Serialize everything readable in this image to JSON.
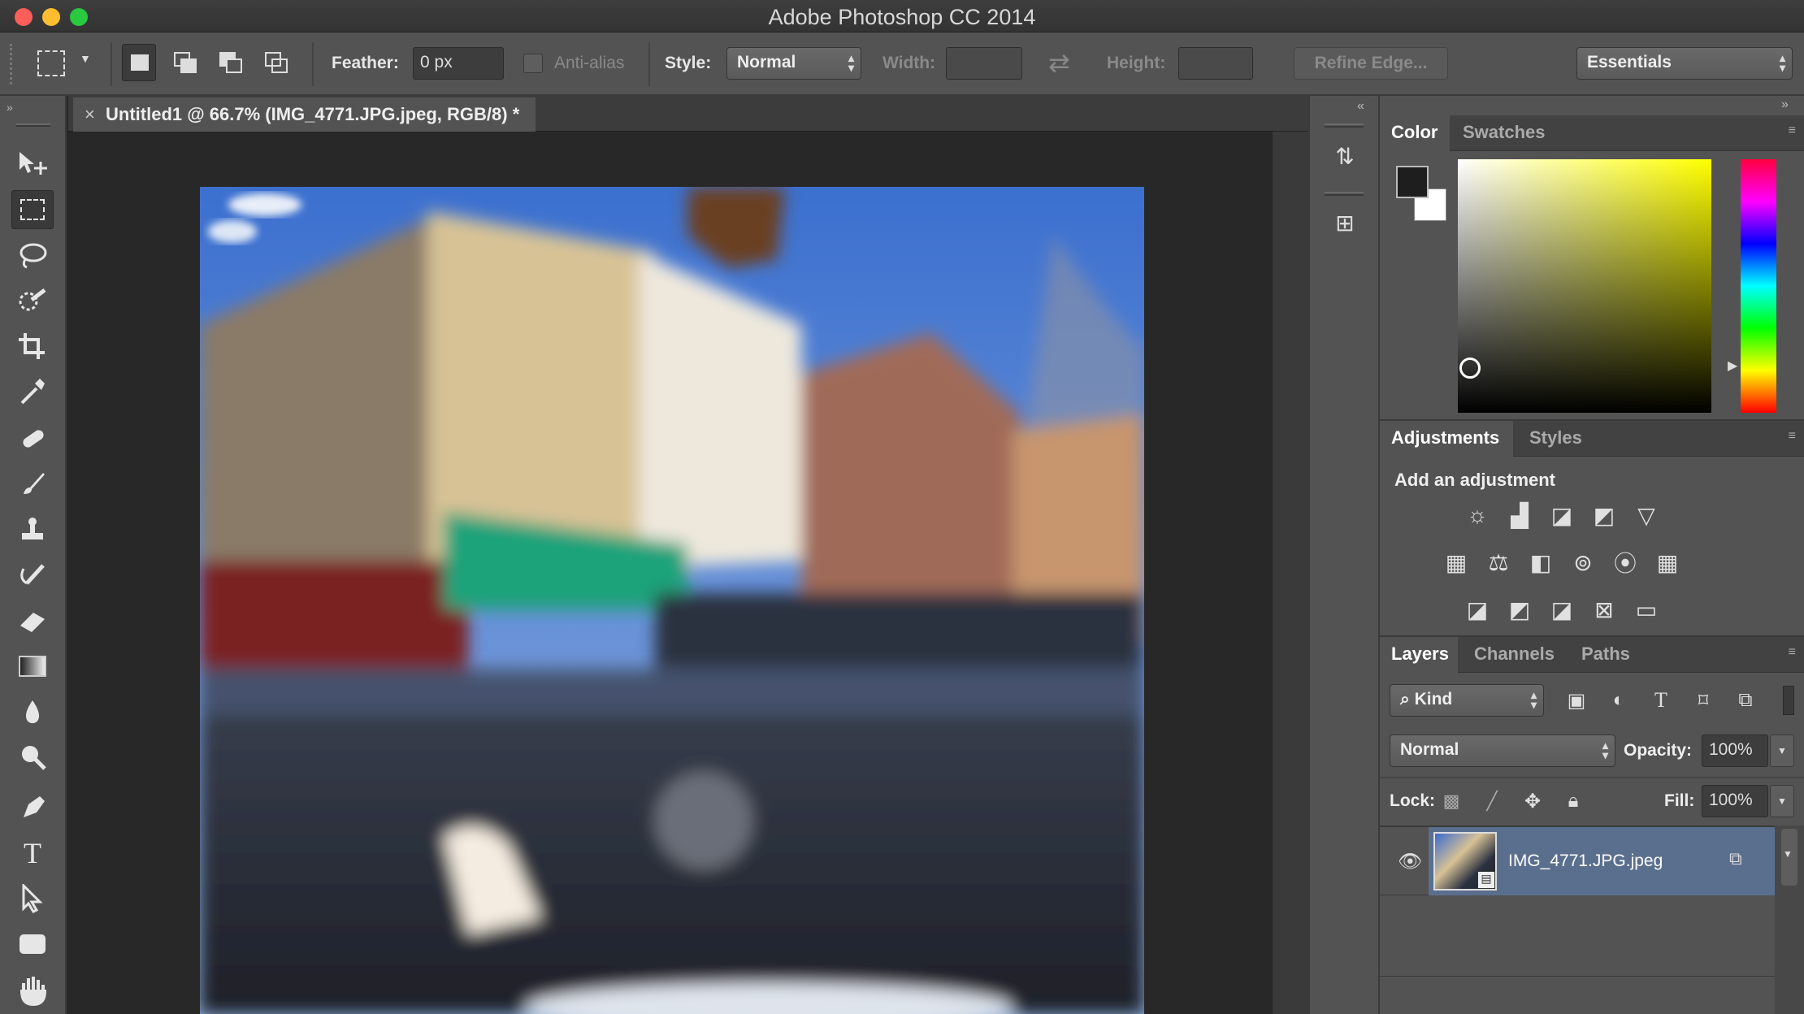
{
  "window": {
    "title": "Adobe Photoshop CC 2014"
  },
  "options_bar": {
    "feather_label": "Feather:",
    "feather_value": "0 px",
    "antialias_label": "Anti-alias",
    "style_label": "Style:",
    "style_value": "Normal",
    "width_label": "Width:",
    "height_label": "Height:",
    "refine_edge_label": "Refine Edge...",
    "workspace_value": "Essentials"
  },
  "document": {
    "tab_title": "Untitled1 @ 66.7% (IMG_4771.JPG.jpeg, RGB/8) *",
    "close_glyph": "×"
  },
  "tools": [
    "move-tool",
    "rectangular-marquee-tool",
    "lasso-tool",
    "quick-selection-tool",
    "crop-tool",
    "eyedropper-tool",
    "spot-healing-brush-tool",
    "brush-tool",
    "clone-stamp-tool",
    "history-brush-tool",
    "eraser-tool",
    "gradient-tool",
    "blur-tool",
    "dodge-tool",
    "pen-tool",
    "type-tool",
    "path-selection-tool",
    "rectangle-tool",
    "hand-tool"
  ],
  "color_panel": {
    "tabs": [
      "Color",
      "Swatches"
    ],
    "foreground_color": "#1e1e1e",
    "background_color": "#ffffff",
    "hue_color": "#ffff00"
  },
  "adjustments_panel": {
    "tabs": [
      "Adjustments",
      "Styles"
    ],
    "heading": "Add an adjustment",
    "icons": [
      [
        "brightness-contrast-icon",
        "levels-icon",
        "curves-icon",
        "exposure-icon",
        "vibrance-icon"
      ],
      [
        "hue-saturation-icon",
        "color-balance-icon",
        "black-white-icon",
        "photo-filter-icon",
        "channel-mixer-icon",
        "color-lookup-icon"
      ],
      [
        "invert-icon",
        "posterize-icon",
        "threshold-icon",
        "selective-color-icon",
        "gradient-map-icon"
      ]
    ]
  },
  "layers_panel": {
    "tabs": [
      "Layers",
      "Channels",
      "Paths"
    ],
    "filter_kind": "Kind",
    "blend_mode": "Normal",
    "opacity_label": "Opacity:",
    "opacity_value": "100%",
    "lock_label": "Lock:",
    "fill_label": "Fill:",
    "fill_value": "100%",
    "layers": [
      {
        "name": "IMG_4771.JPG.jpeg",
        "visible": true,
        "selected": true
      }
    ]
  },
  "colors": {
    "selected_layer": "#5a6f8e",
    "panel_bg": "#535353",
    "canvas_bg": "#282828"
  }
}
